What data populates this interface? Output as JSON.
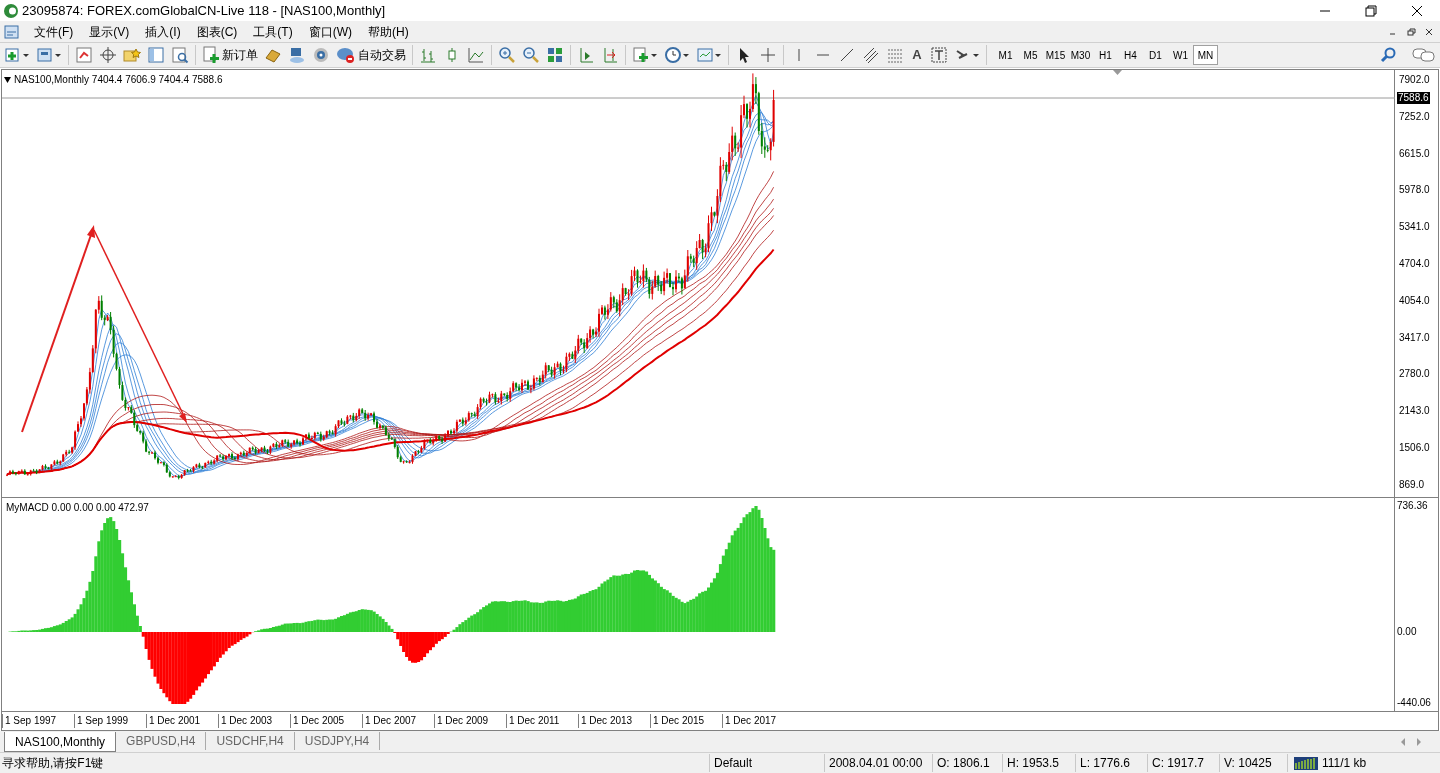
{
  "window": {
    "title": "23095874: FOREX.comGlobalCN-Live 118 - [NAS100,Monthly]"
  },
  "menu": [
    "文件(F)",
    "显示(V)",
    "插入(I)",
    "图表(C)",
    "工具(T)",
    "窗口(W)",
    "帮助(H)"
  ],
  "toolbar": {
    "new_order": "新订单",
    "auto_trading": "自动交易",
    "line_text_tool": "A",
    "timeframes": [
      {
        "label": "M1",
        "selected": false
      },
      {
        "label": "M5",
        "selected": false
      },
      {
        "label": "M15",
        "selected": false
      },
      {
        "label": "M30",
        "selected": false
      },
      {
        "label": "H1",
        "selected": false
      },
      {
        "label": "H4",
        "selected": false
      },
      {
        "label": "D1",
        "selected": false
      },
      {
        "label": "W1",
        "selected": false
      },
      {
        "label": "MN",
        "selected": true
      }
    ]
  },
  "chart": {
    "header": "NAS100,Monthly  7404.4 7606.9 7404.4 7588.6",
    "current_price": "7588.6",
    "price_ticks": [
      "7902.0",
      "7252.0",
      "6615.0",
      "5978.0",
      "5341.0",
      "4704.0",
      "4054.0",
      "3417.0",
      "2780.0",
      "2143.0",
      "1506.0",
      "869.0"
    ],
    "indicator_header": "MyMACD 0.00 0.00 0.00 472.97",
    "indicator_ticks": [
      "736.36",
      "0.00",
      "-440.06"
    ],
    "date_ticks": [
      "1 Sep 1997",
      "1 Sep 1999",
      "1 Dec 2001",
      "1 Dec 2003",
      "1 Dec 2005",
      "1 Dec 2007",
      "1 Dec 2009",
      "1 Dec 2011",
      "1 Dec 2013",
      "1 Dec 2015",
      "1 Dec 2017"
    ]
  },
  "chart_tabs": [
    {
      "label": "NAS100,Monthly",
      "selected": true
    },
    {
      "label": "GBPUSD,H4",
      "selected": false
    },
    {
      "label": "USDCHF,H4",
      "selected": false
    },
    {
      "label": "USDJPY,H4",
      "selected": false
    }
  ],
  "status_bar": {
    "help": "寻求帮助,请按F1键",
    "profile": "Default",
    "time": "2008.04.01 00:00",
    "open": "O: 1806.1",
    "high": "H: 1953.5",
    "low": "L: 1776.6",
    "close": "C: 1917.7",
    "volume": "V: 10425",
    "traffic": "111/1 kb"
  }
}
